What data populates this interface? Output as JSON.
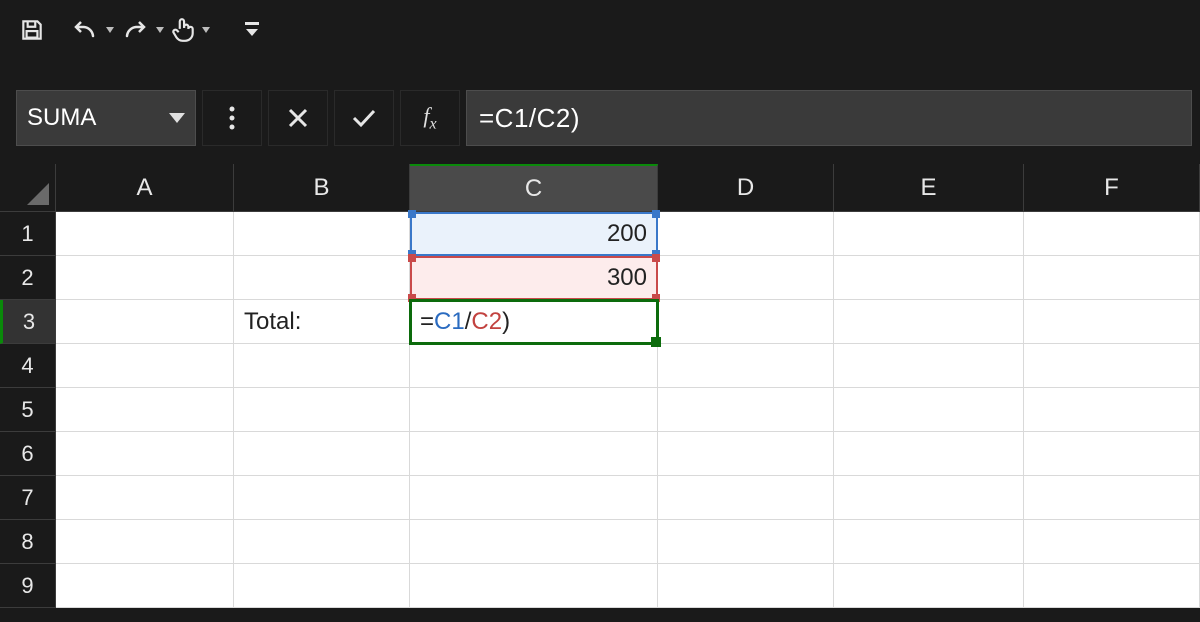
{
  "qat": {
    "save": "save",
    "undo": "undo",
    "redo": "redo",
    "touch": "touch-mode",
    "customize": "customize"
  },
  "namebox": {
    "value": "SUMA"
  },
  "formula_bar": {
    "prefix": "",
    "formula_text": "=C1/C2)",
    "tokens": {
      "eq": "=",
      "ref1": "C1",
      "slash": "/",
      "ref2": "C2",
      "close": ")"
    }
  },
  "columns": [
    "A",
    "B",
    "C",
    "D",
    "E",
    "F"
  ],
  "rows": [
    "1",
    "2",
    "3",
    "4",
    "5",
    "6",
    "7",
    "8",
    "9"
  ],
  "grid": {
    "B3": "Total:",
    "C1": "200",
    "C2": "300",
    "C3_formula": {
      "eq": "=",
      "ref1": "C1",
      "slash": "/",
      "ref2": "C2",
      "close": ")"
    }
  },
  "active_cell": "C3",
  "ref_highlights": [
    {
      "cell": "C1",
      "color": "blue"
    },
    {
      "cell": "C2",
      "color": "red"
    }
  ]
}
